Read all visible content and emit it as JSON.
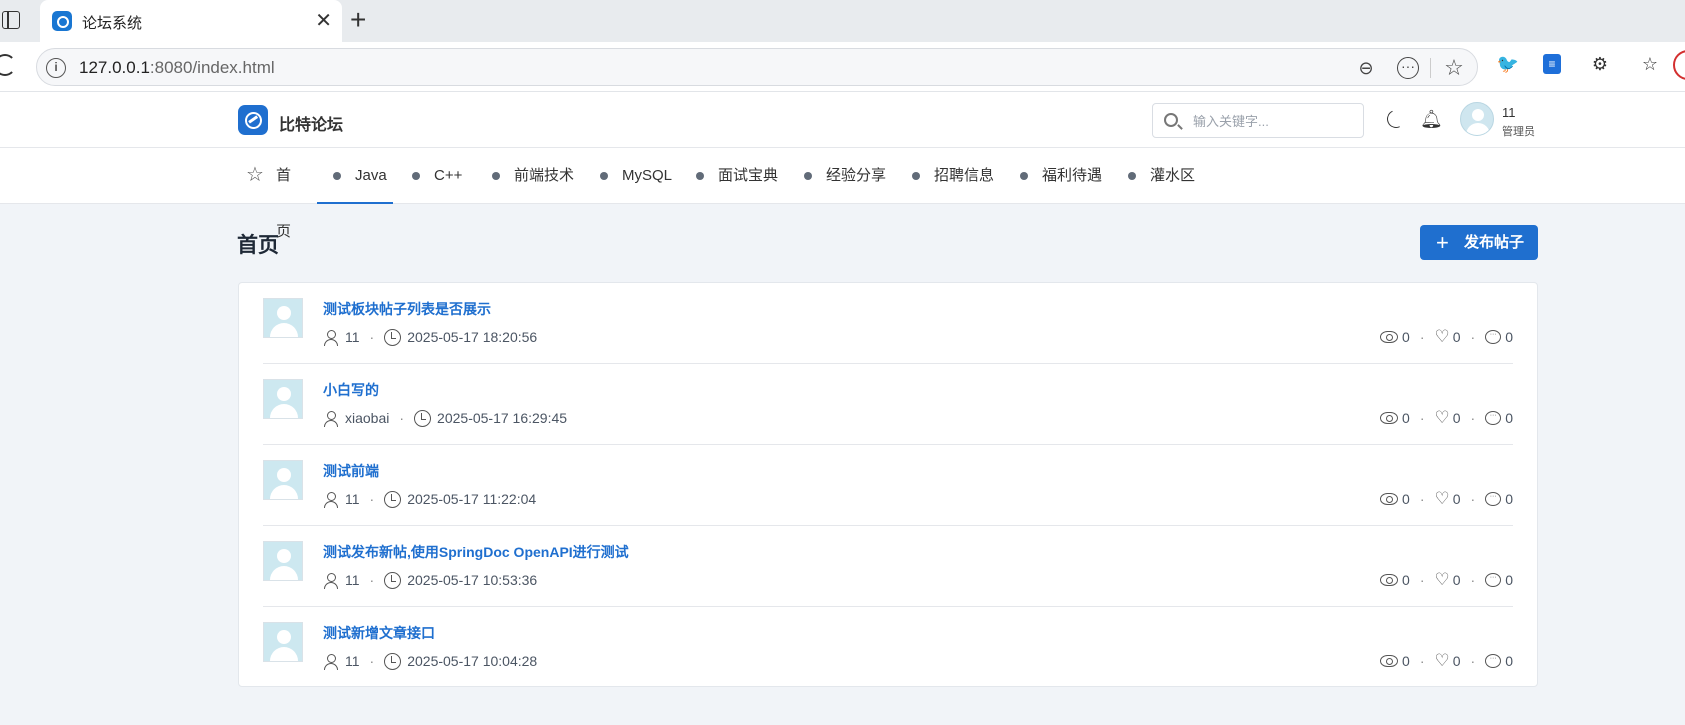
{
  "browser": {
    "tab_title": "论坛系统",
    "url_host": "127.0.0.1",
    "url_rest": ":8080/index.html"
  },
  "header": {
    "brand": "比特论坛",
    "search_placeholder": "输入关键字...",
    "user_name": "11",
    "user_role": "管理员"
  },
  "nav": [
    {
      "label": "首页",
      "icon": "star-icon"
    },
    {
      "label": "Java",
      "active": true
    },
    {
      "label": "C++"
    },
    {
      "label": "前端技术"
    },
    {
      "label": "MySQL"
    },
    {
      "label": "面试宝典"
    },
    {
      "label": "经验分享"
    },
    {
      "label": "招聘信息"
    },
    {
      "label": "福利待遇"
    },
    {
      "label": "灌水区"
    }
  ],
  "main": {
    "title": "首页",
    "publish_label": "发布帖子"
  },
  "posts": [
    {
      "title": "测试板块帖子列表是否展示",
      "author": "11",
      "time": "2025-05-17 18:20:56",
      "views": "0",
      "likes": "0",
      "replies": "0"
    },
    {
      "title": "小白写的",
      "author": "xiaobai",
      "time": "2025-05-17 16:29:45",
      "views": "0",
      "likes": "0",
      "replies": "0"
    },
    {
      "title": "测试前端",
      "author": "11",
      "time": "2025-05-17 11:22:04",
      "views": "0",
      "likes": "0",
      "replies": "0"
    },
    {
      "title": "测试发布新帖,使用SpringDoc OpenAPI进行测试",
      "author": "11",
      "time": "2025-05-17 10:53:36",
      "views": "0",
      "likes": "0",
      "replies": "0"
    },
    {
      "title": "测试新增文章接口",
      "author": "11",
      "time": "2025-05-17 10:04:28",
      "views": "0",
      "likes": "0",
      "replies": "0"
    }
  ],
  "colors": {
    "accent": "#1f6fcf",
    "page_bg": "#f1f4f8"
  }
}
